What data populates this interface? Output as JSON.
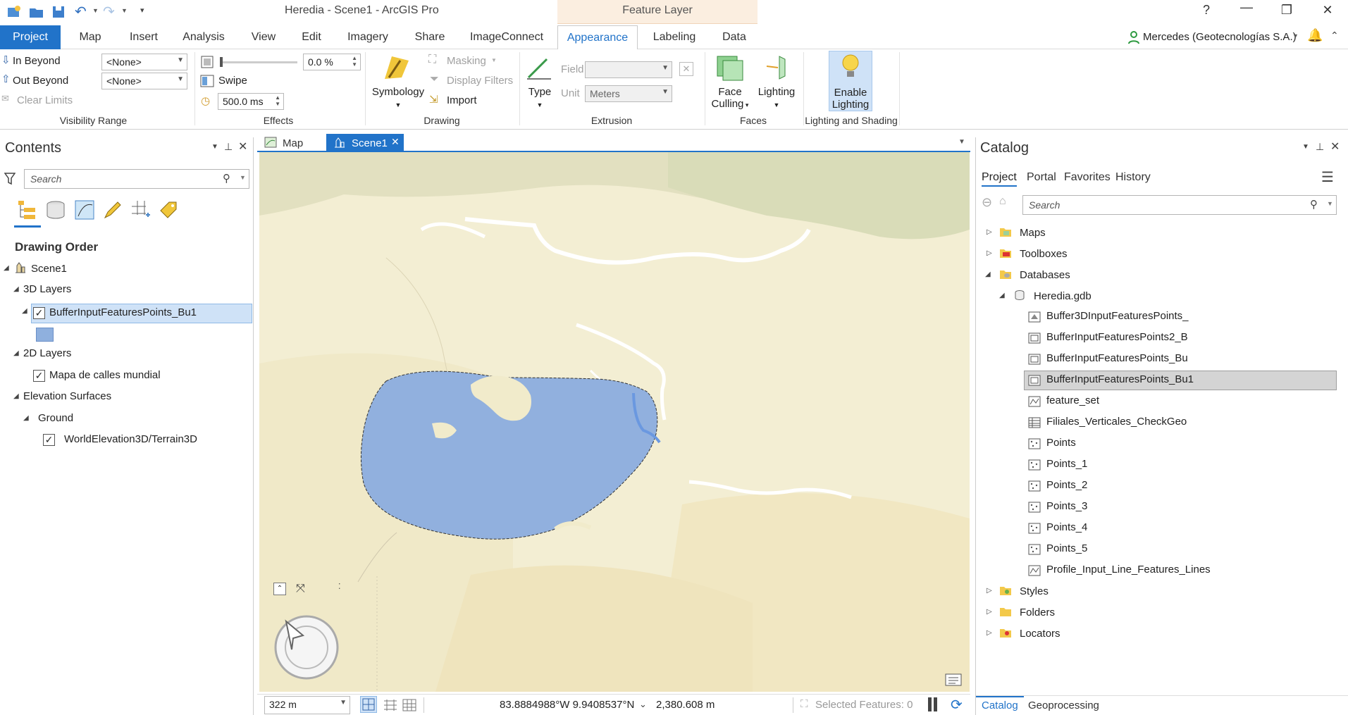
{
  "app": {
    "title": "Heredia - Scene1 - ArcGIS Pro",
    "context_tab_group": "Feature Layer",
    "help": "?",
    "user": "Mercedes (Geotecnologías S.A.)"
  },
  "ribbon_tabs": [
    "Project",
    "Map",
    "Insert",
    "Analysis",
    "View",
    "Edit",
    "Imagery",
    "Share",
    "ImageConnect",
    "Appearance",
    "Labeling",
    "Data"
  ],
  "ribbon": {
    "visibility": {
      "in_beyond": "In Beyond",
      "out_beyond": "Out Beyond",
      "clear_limits": "Clear Limits",
      "in_value": "<None>",
      "out_value": "<None>",
      "label": "Visibility Range"
    },
    "effects": {
      "transparency": "0.0 %",
      "swipe": "Swipe",
      "flicker": "500.0  ms",
      "label": "Effects"
    },
    "drawing": {
      "symbology": "Symbology",
      "masking": "Masking",
      "display_filters": "Display Filters",
      "import": "Import",
      "label": "Drawing"
    },
    "extrusion": {
      "type": "Type",
      "field": "Field",
      "unit": "Unit",
      "unit_value": "Meters",
      "label": "Extrusion"
    },
    "faces": {
      "face_culling_1": "Face",
      "face_culling_2": "Culling",
      "lighting": "Lighting",
      "label": "Faces"
    },
    "lighting_shading": {
      "enable_1": "Enable",
      "enable_2": "Lighting",
      "label": "Lighting and Shading"
    }
  },
  "contents": {
    "title": "Contents",
    "search_placeholder": "Search",
    "drawing_order": "Drawing Order",
    "scene": "Scene1",
    "layers_3d": "3D Layers",
    "layer_buffer": "BufferInputFeaturesPoints_Bu1",
    "layers_2d": "2D Layers",
    "layer_streets": "Mapa de calles mundial",
    "elevation": "Elevation Surfaces",
    "ground": "Ground",
    "terrain": "WorldElevation3D/Terrain3D"
  },
  "doc_tabs": {
    "map": "Map",
    "scene": "Scene1"
  },
  "status": {
    "scale": "322 m",
    "coords": "83.8884988°W 9.9408537°N",
    "elevation": "2,380.608 m",
    "selected": "Selected Features: 0"
  },
  "catalog": {
    "title": "Catalog",
    "tabs": [
      "Project",
      "Portal",
      "Favorites",
      "History"
    ],
    "search_placeholder": "Search",
    "maps": "Maps",
    "toolboxes": "Toolboxes",
    "databases": "Databases",
    "gdb": "Heredia.gdb",
    "items": [
      "Buffer3DInputFeaturesPoints_",
      "BufferInputFeaturesPoints2_B",
      "BufferInputFeaturesPoints_Bu",
      "BufferInputFeaturesPoints_Bu1",
      "feature_set",
      "Filiales_Verticales_CheckGeo",
      "Points",
      "Points_1",
      "Points_2",
      "Points_3",
      "Points_4",
      "Points_5",
      "Profile_Input_Line_Features_Lines"
    ],
    "styles": "Styles",
    "folders": "Folders",
    "locators": "Locators",
    "bottom_tabs": [
      "Catalog",
      "Geoprocessing"
    ]
  },
  "colors": {
    "accent": "#2173c9",
    "polygon": "#8fb0de",
    "terrain": "#f2edcf",
    "selection": "#cfe2f7"
  }
}
